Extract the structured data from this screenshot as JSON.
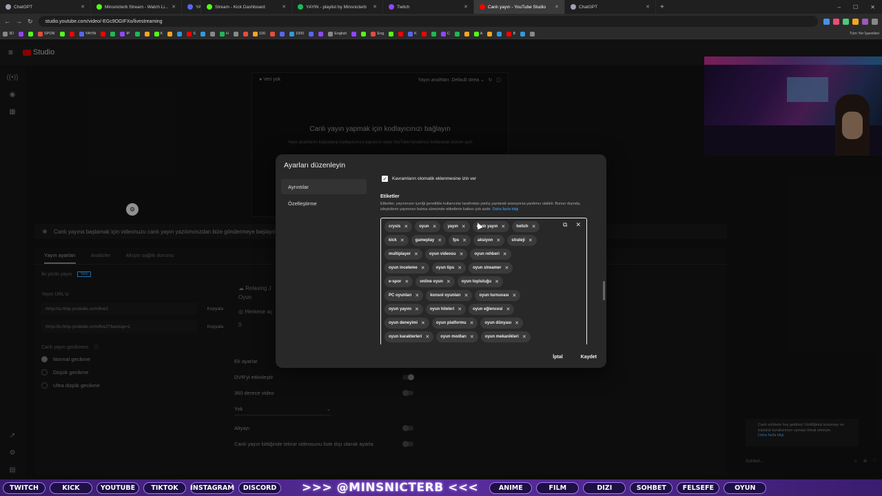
{
  "browser": {
    "tabs": [
      {
        "label": "ChatGPT",
        "color": "#9ca3af"
      },
      {
        "label": "Minsnicterb Stream - Watch Li...",
        "color": "#53fc18"
      },
      {
        "label": "YAYIN",
        "color": "#5865f2"
      },
      {
        "label": "Stream - Kick Dashboard",
        "color": "#53fc18"
      },
      {
        "label": "YAYIN - playlist by Minsnicterb",
        "color": "#1db954"
      },
      {
        "label": "Twitch",
        "color": "#9146ff"
      },
      {
        "label": "Canlı yayın - YouTube Studio",
        "color": "#ff0000",
        "active": true
      },
      {
        "label": "ChatGPT",
        "color": "#9ca3af"
      }
    ],
    "url": "studio.youtube.com/video/-EGc9OGIFXo/livestreaming",
    "bookmarks": [
      "3D",
      "SPOR",
      "YAYIN",
      "IP",
      "K",
      "S",
      "H",
      "100",
      "1000",
      "English",
      "Eng",
      "K",
      "C",
      "A",
      "B"
    ],
    "bookmarks_right": "Tüm Yer İşaretleri"
  },
  "studio": {
    "logo": "Studio",
    "preview": {
      "no_data": "Veri yok",
      "stream_key": "Yayın anahtarı: Default strea",
      "title": "Canlı yayın yapmak için kodlayıcınızı bağlayın",
      "subtitle": "Yayın anahtarını kopyalayıp kodlayıcınıza yapıştırın veya YouTube hesabınızı kullanarak oturum açın"
    },
    "status": "Canlı yayına başlamak için videonuzu canlı yayın yazılımınızdan bize göndermeye başlayın",
    "tabs": [
      "Yayın ayarları",
      "Analizler",
      "Akışın sağlık durumu"
    ],
    "two_way": "İki yönlü yayın",
    "new_badge": "Yeni",
    "url_label": "Yayın URL'si",
    "rtmp1": "rtmp://a.rtmp.youtube.com/live2",
    "rtmp2": "rtmp://b.rtmp.youtube.com/live2?backup=1",
    "copy": "Kopyala",
    "latency_label": "Canlı yayın gecikmesi",
    "latency_options": [
      "Normal gecikme",
      "Düşük gecikme",
      "Ultra düşük gecikme"
    ],
    "title_field": "Relaxing J",
    "category": "Oyun",
    "privacy": "Herkese aç",
    "viewers": "0",
    "extra_settings": "Ek ayarlar",
    "dvr": "DVR'yi etkinleştir",
    "video360": "360 derece video",
    "none": "Yok",
    "subtitles": "Altyazı",
    "unlist": "Canlı yayın bittiğinde tekrar videosunu liste dışı olarak ayarla"
  },
  "chat": {
    "notice": "Canlı sohbete hoş geldiniz! Gizliliğinizi korumayı ve topluluk kurallarımızı uymayı ihmal etmeyin.",
    "learn_more": "Daha fazla bilgi",
    "placeholder": "Sohbet..."
  },
  "dialog": {
    "title": "Ayarları düzenleyin",
    "nav": [
      "Ayrıntılar",
      "Özelleştirme"
    ],
    "allow_concepts": "Kavramların otomatik eklenmesine izin ver",
    "tags_heading": "Etiketler",
    "tags_desc": "Etiketler, yayınınızın içeriği genellikle kullanıcılar tarafından yanlış yazılarak aranıyorsa yardımcı olabilir. Bunun dışında, izleyicilerin yayınınızı bulma sürecinde etiketlerin katkısı çok azdır.",
    "tags_link": "Daha fazla bilgi",
    "tag_rows": [
      [
        "crysis",
        "oyun",
        "yayın",
        "canlı yayın",
        "twitch"
      ],
      [
        "kick",
        "gameplay",
        "fps",
        "aksiyon",
        "strateji"
      ],
      [
        "multiplayer",
        "oyun videosu",
        "oyun rehberi"
      ],
      [
        "oyun inceleme",
        "oyun tips",
        "oyun streamer"
      ],
      [
        "e-spor",
        "online oyun",
        "oyun topluluğu"
      ],
      [
        "PC oyunları",
        "konsol oyunları",
        "oyun turnuvası"
      ],
      [
        "oyun yayını",
        "oyun hileleri",
        "oyun eğlencesi"
      ],
      [
        "oyun deneyimi",
        "oyun platformu",
        "oyun dünyası"
      ],
      [
        "oyun karakterleri",
        "oyun modları",
        "oyun mekanikleri"
      ]
    ],
    "cancel": "İptal",
    "save": "Kaydet"
  },
  "stream_bar": {
    "left": [
      "TWITCH",
      "KICK",
      "YOUTUBE",
      "TIKTOK",
      "INSTAGRAM",
      "DISCORD"
    ],
    "handle": ">>> @MINSNICTERB <<<",
    "right": [
      "ANIME",
      "FILM",
      "DIZI",
      "SOHBET",
      "FELSEFE",
      "OYUN"
    ]
  }
}
